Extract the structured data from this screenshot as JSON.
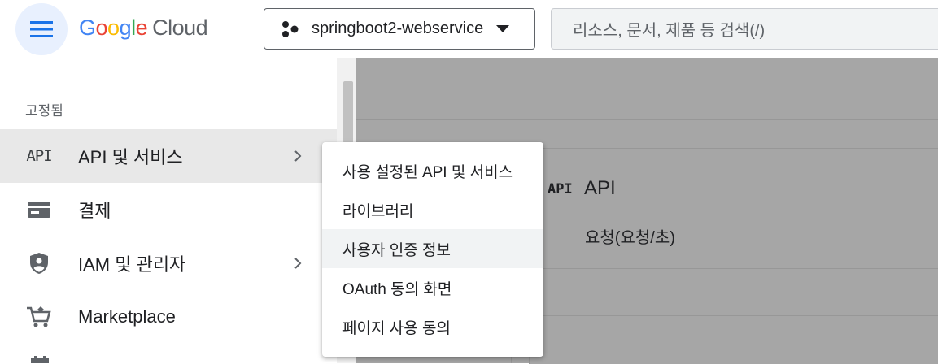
{
  "header": {
    "logo_google": "Google",
    "logo_cloud": "Cloud",
    "project_name": "springboot2-webservice",
    "search_placeholder": "리소스, 문서, 제품 등 검색(/)"
  },
  "sidebar": {
    "section_label": "고정됨",
    "items": [
      {
        "label": "API 및 서비스",
        "icon": "api-icon",
        "icon_text": "API",
        "has_submenu": true,
        "active": true
      },
      {
        "label": "결제",
        "icon": "billing-card-icon",
        "has_submenu": false
      },
      {
        "label": "IAM 및 관리자",
        "icon": "shield-person-icon",
        "has_submenu": true
      },
      {
        "label": "Marketplace",
        "icon": "cart-icon",
        "has_submenu": false
      }
    ]
  },
  "submenu": {
    "items": [
      {
        "label": "사용 설정된 API 및 서비스"
      },
      {
        "label": "라이브러리"
      },
      {
        "label": "사용자 인증 정보",
        "hover": true
      },
      {
        "label": "OAuth 동의 화면"
      },
      {
        "label": "페이지 사용 동의"
      }
    ]
  },
  "main": {
    "card_icon_text": "API",
    "card_title": "API",
    "card_subtitle": "요청(요청/초)"
  },
  "colors": {
    "accent": "#1a73e8",
    "menu_button_bg": "#e8f0fe",
    "overlay": "#a6a6a6"
  }
}
